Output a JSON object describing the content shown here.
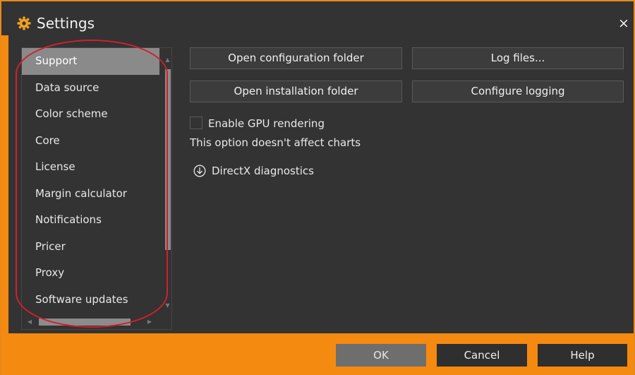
{
  "window": {
    "title": "Settings",
    "close_label": "×"
  },
  "sidebar": {
    "items": [
      {
        "label": "Support",
        "selected": true
      },
      {
        "label": "Data source"
      },
      {
        "label": "Color scheme"
      },
      {
        "label": "Core"
      },
      {
        "label": "License"
      },
      {
        "label": "Margin calculator"
      },
      {
        "label": "Notifications"
      },
      {
        "label": "Pricer"
      },
      {
        "label": "Proxy"
      },
      {
        "label": "Software updates"
      }
    ]
  },
  "support": {
    "open_config_label": "Open configuration folder",
    "log_files_label": "Log files...",
    "open_install_label": "Open installation folder",
    "configure_logging_label": "Configure logging",
    "gpu_checkbox_label": "Enable GPU rendering",
    "gpu_checked": false,
    "gpu_hint": "This option doesn't affect charts",
    "directx_label": "DirectX diagnostics"
  },
  "footer": {
    "ok_label": "OK",
    "cancel_label": "Cancel",
    "help_label": "Help"
  },
  "colors": {
    "accent": "#f48a0f",
    "panel": "#333333",
    "selected_item": "#8a8a8a",
    "annotation": "#d1202e"
  },
  "icons": {
    "title": "gear-icon",
    "close": "close-icon",
    "directx": "chevron-down-circle-icon"
  }
}
